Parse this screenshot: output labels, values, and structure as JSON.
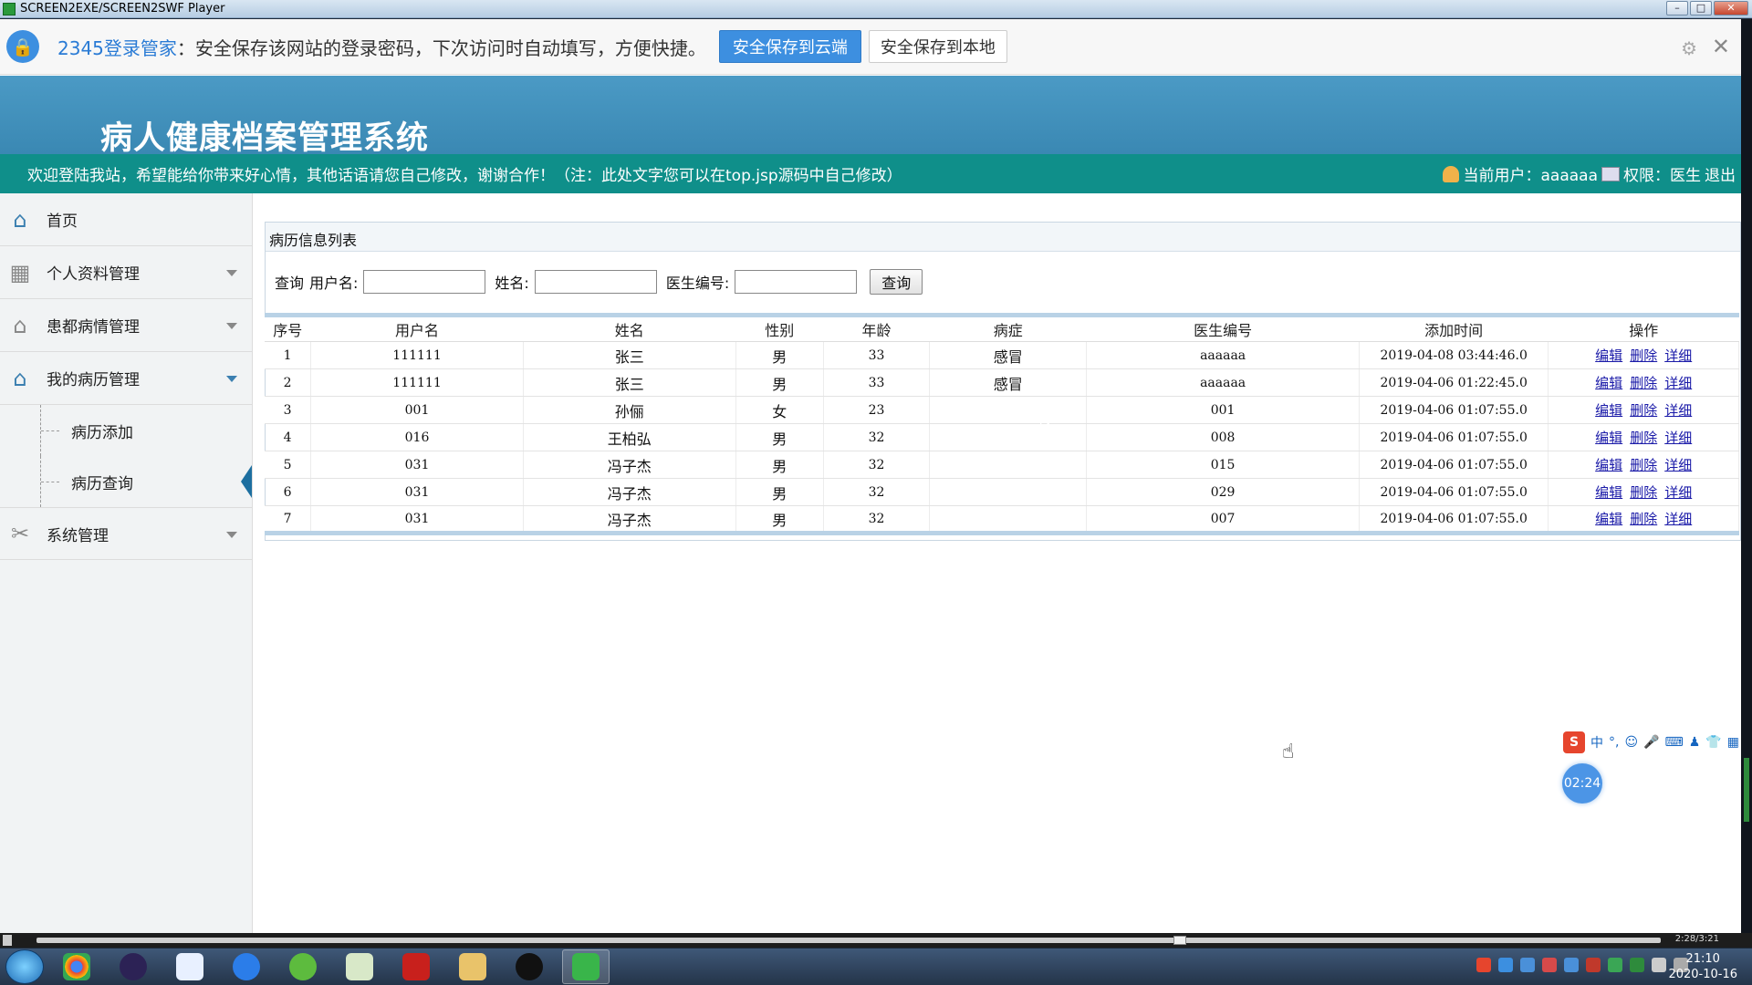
{
  "window": {
    "title": "SCREEN2EXE/SCREEN2SWF Player"
  },
  "password_bar": {
    "brand": "2345登录管家",
    "message": "：安全保存该网站的登录密码，下次访问时自动填写，方便快捷。",
    "save_cloud": "安全保存到云端",
    "save_local": "安全保存到本地"
  },
  "header": {
    "title": "病人健康档案管理系统"
  },
  "marquee": {
    "message": "欢迎登陆我站，希望能给你带来好心情，其他话语请您自己修改，谢谢合作！（注：此处文字您可以在top.jsp源码中自己修改）",
    "current_user_label": "当前用户：aaaaaa",
    "role_label": "权限：医生",
    "logout": "退出"
  },
  "sidebar": {
    "home": "首页",
    "items": [
      {
        "label": "个人资料管理"
      },
      {
        "label": "患都病情管理"
      },
      {
        "label": "我的病历管理"
      }
    ],
    "sub_items": [
      {
        "label": "病历添加"
      },
      {
        "label": "病历查询"
      }
    ],
    "system": "系统管理"
  },
  "panel": {
    "title": "病历信息列表",
    "query_label": "查询",
    "username_label": "用户名:",
    "name_label": "姓名:",
    "doctor_no_label": "医生编号:",
    "username_value": "",
    "name_value": "",
    "doctor_no_value": "",
    "search_button": "查询"
  },
  "table": {
    "headers": [
      "序号",
      "用户名",
      "姓名",
      "性别",
      "年龄",
      "病症",
      "医生编号",
      "添加时间",
      "操作"
    ],
    "rows": [
      {
        "no": "1",
        "username": "111111",
        "name": "张三",
        "gender": "男",
        "age": "33",
        "illness": "感冒",
        "doctor_no": "aaaaaa",
        "time": "2019-04-08 03:44:46.0"
      },
      {
        "no": "2",
        "username": "111111",
        "name": "张三",
        "gender": "男",
        "age": "33",
        "illness": "感冒",
        "doctor_no": "aaaaaa",
        "time": "2019-04-06 01:22:45.0"
      },
      {
        "no": "3",
        "username": "001",
        "name": "孙俪",
        "gender": "女",
        "age": "23",
        "illness": "",
        "doctor_no": "001",
        "time": "2019-04-06 01:07:55.0"
      },
      {
        "no": "4",
        "username": "016",
        "name": "王柏弘",
        "gender": "男",
        "age": "32",
        "illness": "",
        "doctor_no": "008",
        "time": "2019-04-06 01:07:55.0"
      },
      {
        "no": "5",
        "username": "031",
        "name": "冯子杰",
        "gender": "男",
        "age": "32",
        "illness": "",
        "doctor_no": "015",
        "time": "2019-04-06 01:07:55.0"
      },
      {
        "no": "6",
        "username": "031",
        "name": "冯子杰",
        "gender": "男",
        "age": "32",
        "illness": "",
        "doctor_no": "029",
        "time": "2019-04-06 01:07:55.0"
      },
      {
        "no": "7",
        "username": "031",
        "name": "冯子杰",
        "gender": "男",
        "age": "32",
        "illness": "",
        "doctor_no": "007",
        "time": "2019-04-06 01:07:55.0"
      }
    ],
    "actions": [
      "编辑",
      "删除",
      "详细"
    ]
  },
  "overlay": {
    "timer": "02:24",
    "ime_label": "中"
  },
  "player": {
    "time": "2:28/3:21",
    "progress": 0.7
  },
  "taskbar": {
    "time": "21:10",
    "date": "2020-10-16"
  },
  "colors": {
    "header": "#3e8eb7",
    "marquee": "#0f8f8a",
    "accent": "#3d8fe0"
  }
}
